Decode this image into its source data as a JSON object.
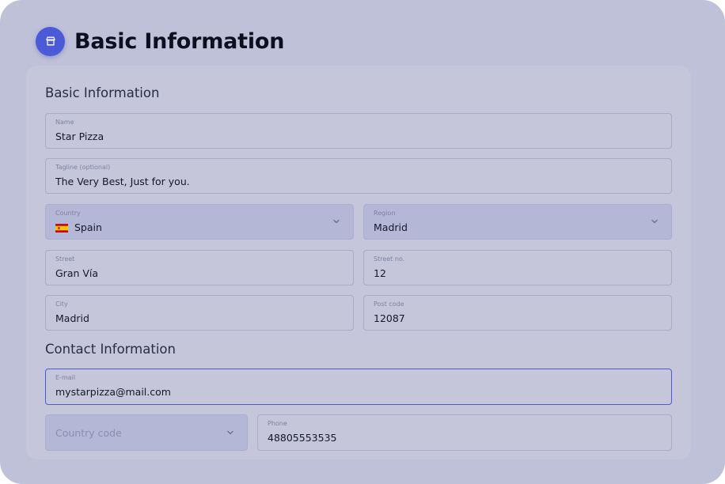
{
  "header": {
    "title": "Basic Information",
    "icon": "storefront-icon"
  },
  "basic_section": {
    "title": "Basic Information",
    "name": {
      "label": "Name",
      "value": "Star Pizza"
    },
    "tagline": {
      "label": "Tagline (optional)",
      "value": "The Very Best, Just for you."
    },
    "country": {
      "label": "Country",
      "value": "Spain",
      "flag": "spain-flag-icon"
    },
    "region": {
      "label": "Region",
      "value": "Madrid"
    },
    "street": {
      "label": "Street",
      "value": "Gran Vía"
    },
    "street_no": {
      "label": "Street no.",
      "value": "12"
    },
    "city": {
      "label": "City",
      "value": "Madrid"
    },
    "post_code": {
      "label": "Post code",
      "value": "12087"
    }
  },
  "contact_section": {
    "title": "Contact Information",
    "email": {
      "label": "E-mail",
      "value": "mystarpizza@mail.com"
    },
    "country_code": {
      "placeholder": "Country code"
    },
    "phone": {
      "label": "Phone",
      "value": "48805553535"
    }
  },
  "colors": {
    "accent": "#4b5bd8",
    "background": "#bfc1d9",
    "card": "#c5c6da"
  }
}
